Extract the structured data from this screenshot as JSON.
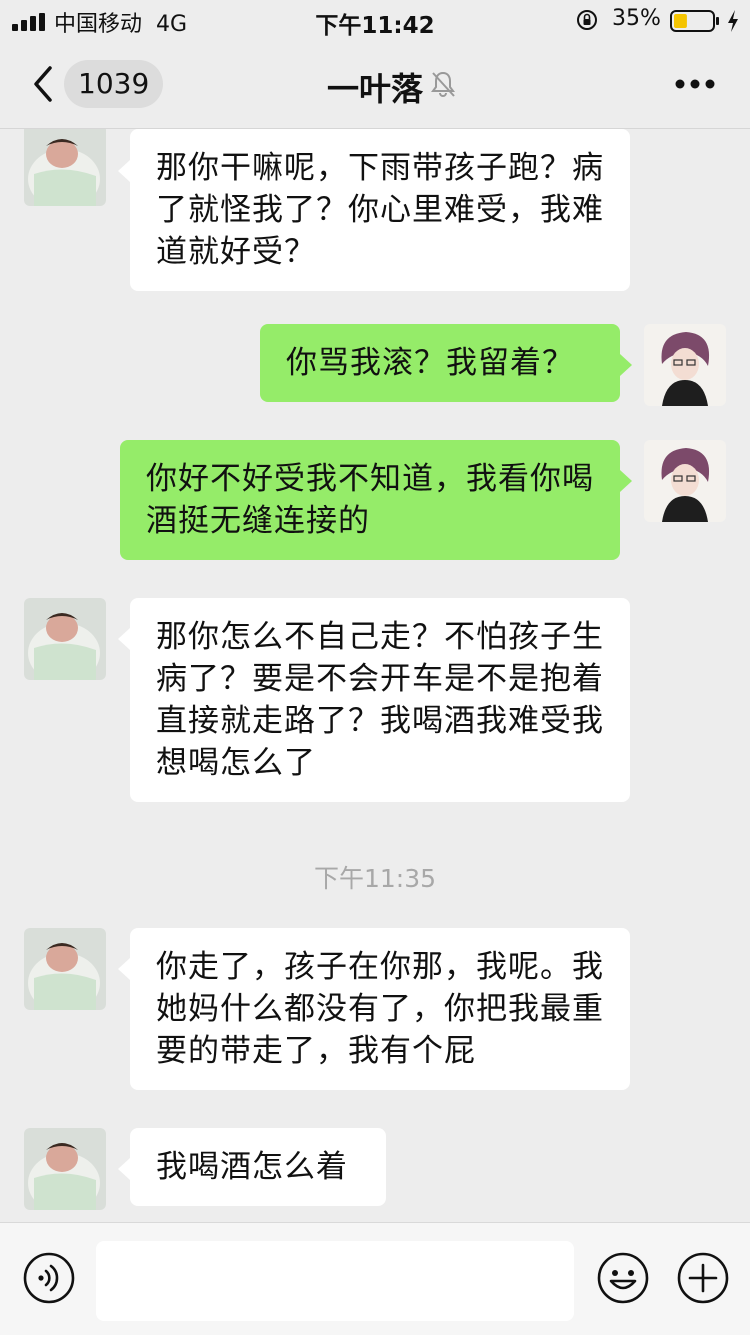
{
  "status_bar": {
    "carrier": "中国移动",
    "network": "4G",
    "time": "下午11:42",
    "battery_percent": "35%",
    "battery_level": 0.35
  },
  "nav": {
    "unread_count": "1039",
    "title": "一叶落"
  },
  "messages": [
    {
      "side": "in",
      "text": "那你干嘛呢，下雨带孩子跑？病了就怪我了？你心里难受，我难道就好受？"
    },
    {
      "side": "out",
      "text": "你骂我滚？我留着？"
    },
    {
      "side": "out",
      "text": "你好不好受我不知道，我看你喝酒挺无缝连接的"
    },
    {
      "side": "in",
      "text": "那你怎么不自己走？不怕孩子生病了？要是不会开车是不是抱着直接就走路了？我喝酒我难受我想喝怎么了"
    },
    {
      "side": "in",
      "text": "你走了，孩子在你那，我呢。我她妈什么都没有了，你把我最重要的带走了，我有个屁"
    },
    {
      "side": "in",
      "text": "我喝酒怎么着"
    }
  ],
  "timestamp": "下午11:35",
  "colors": {
    "background": "#ededed",
    "bubble_out": "#95ec69",
    "bubble_in": "#ffffff",
    "timestamp_text": "#a8a8a8"
  },
  "icons": {
    "back": "chevron-left-icon",
    "mute": "bell-muted-icon",
    "more": "more-dots-icon",
    "voice": "voice-icon",
    "emoji": "emoji-icon",
    "plus": "plus-icon"
  }
}
